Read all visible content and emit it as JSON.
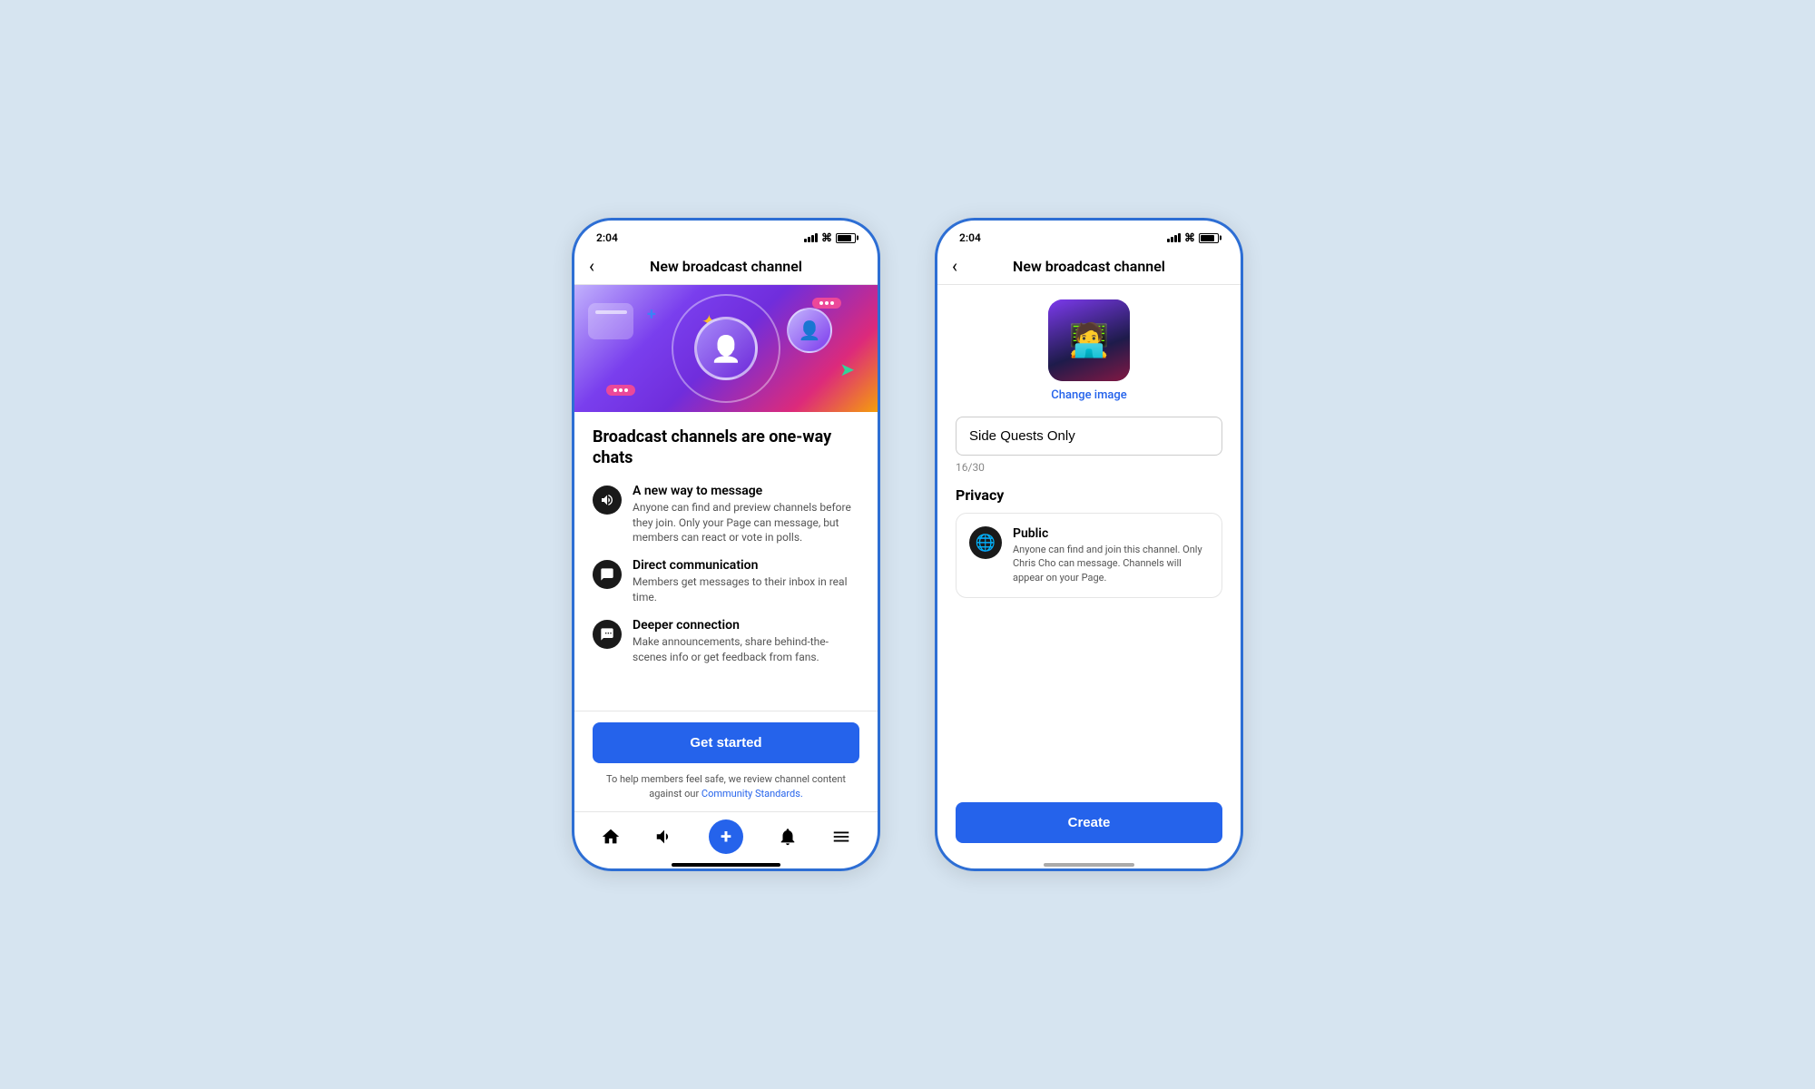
{
  "background": "#d6e4f0",
  "phone1": {
    "status_time": "2:04",
    "nav_title": "New broadcast channel",
    "back_icon": "‹",
    "hero_alt": "Broadcast channel illustration",
    "broadcast_title": "Broadcast channels are one-way chats",
    "features": [
      {
        "id": "new-way",
        "icon": "megaphone",
        "heading": "A new way to message",
        "desc": "Anyone can find and preview channels before they join. Only your Page can message, but members can react or vote in polls."
      },
      {
        "id": "direct",
        "icon": "chat",
        "heading": "Direct communication",
        "desc": "Members get messages to their inbox in real time."
      },
      {
        "id": "deeper",
        "icon": "heart-chat",
        "heading": "Deeper connection",
        "desc": "Make announcements, share behind-the-scenes info or get feedback from fans."
      }
    ],
    "get_started_label": "Get started",
    "community_text": "To help members feel safe, we review channel content against our ",
    "community_link": "Community Standards.",
    "nav_items": [
      "home",
      "megaphone",
      "plus",
      "bell",
      "menu"
    ]
  },
  "phone2": {
    "status_time": "2:04",
    "nav_title": "New broadcast channel",
    "back_icon": "‹",
    "change_image_label": "Change image",
    "channel_name_value": "Side Quests Only",
    "channel_name_placeholder": "Channel name",
    "char_count": "16/30",
    "privacy_section_title": "Privacy",
    "privacy_option": {
      "icon": "globe",
      "heading": "Public",
      "desc": "Anyone can find and join this channel. Only Chris Cho can message. Channels will appear on your Page."
    },
    "create_label": "Create"
  }
}
